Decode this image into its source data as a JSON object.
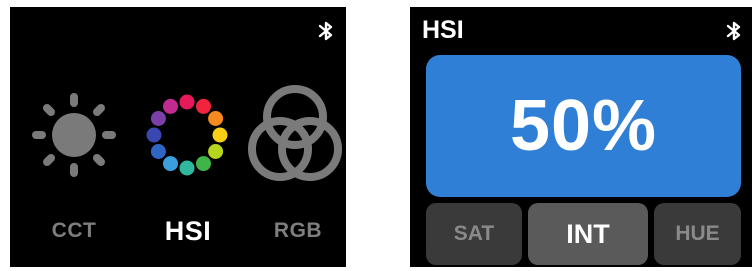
{
  "left_screen": {
    "modes": [
      {
        "id": "cct",
        "label": "CCT",
        "icon": "sun-icon"
      },
      {
        "id": "hsi",
        "label": "HSI",
        "icon": "color-wheel-icon"
      },
      {
        "id": "rgb",
        "label": "RGB",
        "icon": "rgb-circles-icon"
      }
    ],
    "selected_mode": "HSI",
    "bluetooth_icon": "bluetooth-icon"
  },
  "right_screen": {
    "title": "HSI",
    "value": "50%",
    "parameters": [
      {
        "id": "sat",
        "label": "SAT"
      },
      {
        "id": "int",
        "label": "INT"
      },
      {
        "id": "hue",
        "label": "HUE"
      }
    ],
    "selected_parameter": "INT",
    "bluetooth_icon": "bluetooth-icon"
  },
  "colors": {
    "screen_bg": "#000000",
    "accent_blue": "#2f7fd6",
    "inactive_gray": "#7e7e7e",
    "icon_gray": "#7a7a7a",
    "selected_text": "#ffffff",
    "color_wheel": [
      "#e6195a",
      "#f0243c",
      "#f68a1e",
      "#f7d016",
      "#b6d61e",
      "#3fb549",
      "#2fb89e",
      "#3a9fdc",
      "#2f66c4",
      "#3b47b0",
      "#7b3fa8",
      "#c12a8f"
    ]
  }
}
